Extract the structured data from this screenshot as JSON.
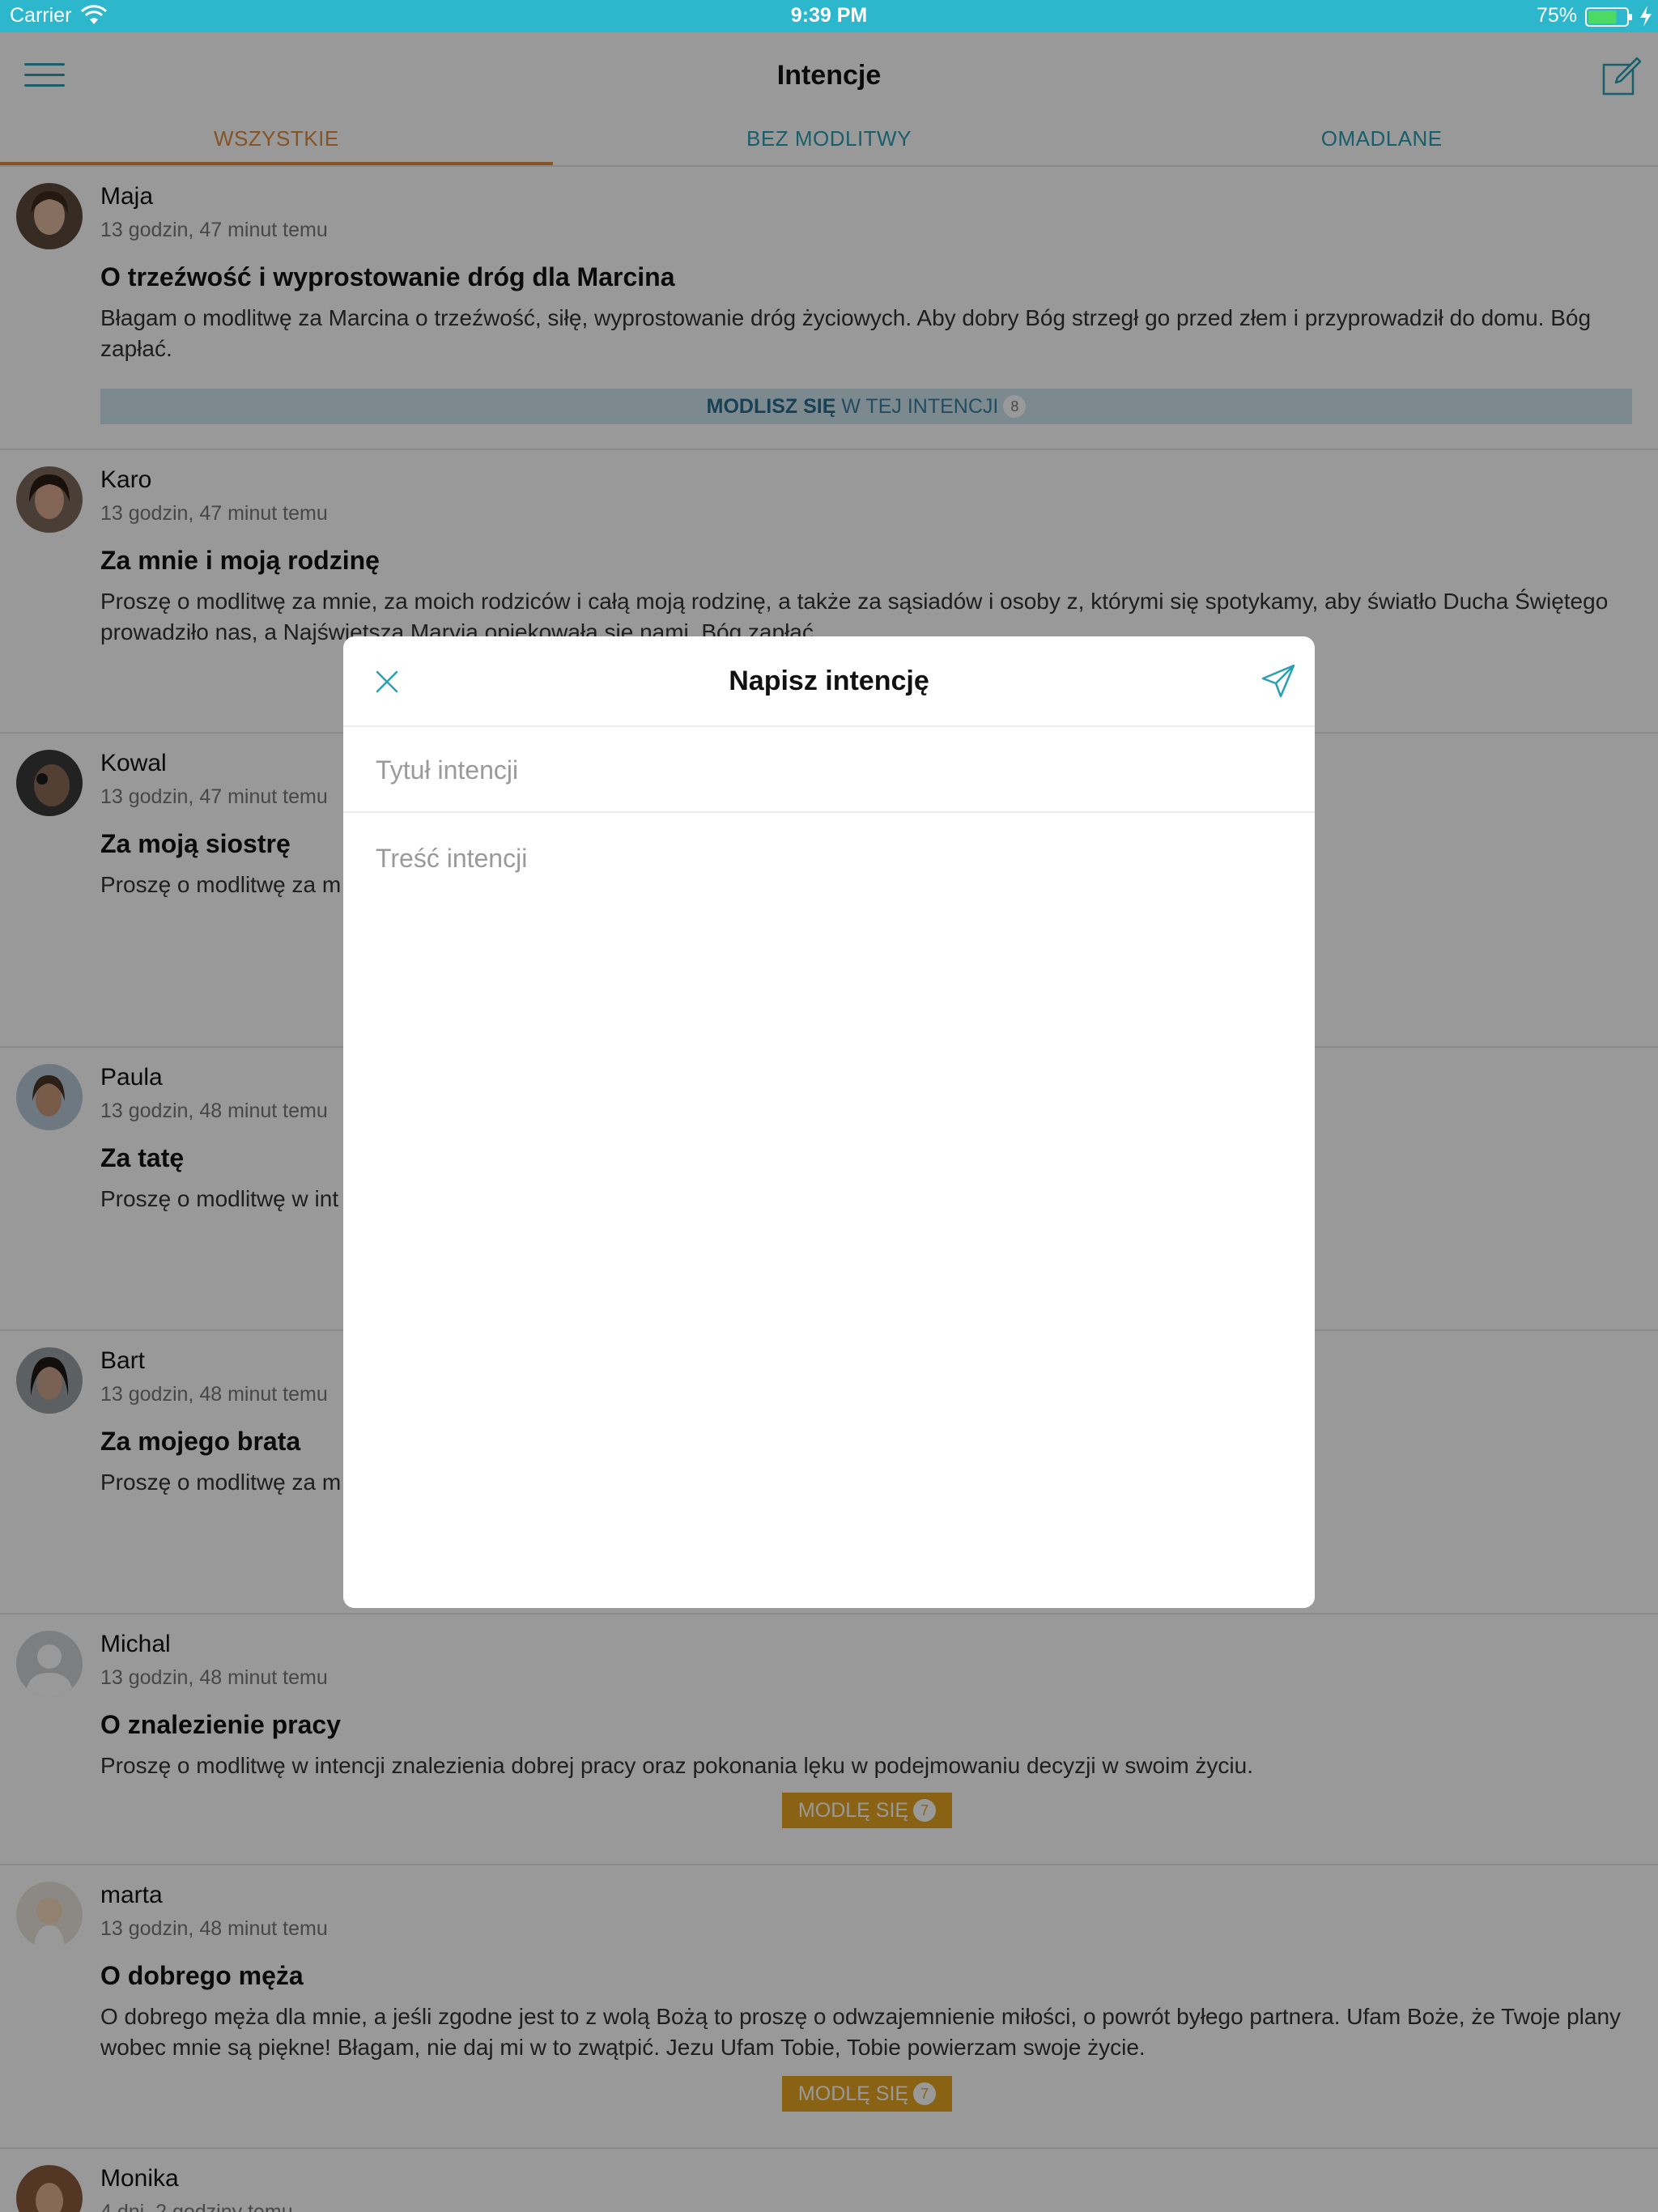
{
  "status_bar": {
    "carrier": "Carrier",
    "time": "9:39 PM",
    "battery": "75%",
    "battery_level": 0.75
  },
  "nav": {
    "title": "Intencje"
  },
  "tabs": [
    {
      "label": "WSZYSTKIE",
      "active": true
    },
    {
      "label": "BEZ MODLITWY",
      "active": false
    },
    {
      "label": "OMADLANE",
      "active": false
    }
  ],
  "posts": [
    {
      "author": "Maja",
      "ago": "13 godzin, 47 minut temu",
      "title": "O trzeźwość i wyprostowanie dróg dla Marcina",
      "body": "Błagam o modlitwę za Marcina o trzeźwość, siłę, wyprostowanie dróg życiowych. Aby dobry Bóg strzegł go przed złem i przyprowadził do domu. Bóg zapłać.",
      "action_bold": "MODLISZ SIĘ",
      "action_rest": " W TEJ INTENCJI",
      "count": "8"
    },
    {
      "author": "Karo",
      "ago": "13 godzin, 47 minut temu",
      "title": "Za mnie i moją rodzinę",
      "body": "Proszę o modlitwę za mnie, za moich rodziców i całą moją rodzinę, a także za sąsiadów i osoby z, którymi się spotykamy, aby światło Ducha Świętego prowadziło nas, a Najświętsza Maryja opiekowała się nami. Bóg zapłać."
    },
    {
      "author": "Kowal",
      "ago": "13 godzin, 47 minut temu",
      "title": "Za moją siostrę",
      "body": "Proszę o modlitwę za m                                                                                                                  ona, kiedy próbujemy jej pomóc, odpycha nas je                                                                                                                oprowadza nas do łez. Dziękuję wszystkim, kto"
    },
    {
      "author": "Paula",
      "ago": "13 godzin, 48 minut temu",
      "title": "Za tatę",
      "body": "Proszę o modlitwę w int                                                                                                                   ślubowanie abstynencji od alkoholu. Wierzę, że wy"
    },
    {
      "author": "Bart",
      "ago": "13 godzin, 48 minut temu",
      "title": "Za mojego brata",
      "body": "Proszę o modlitwę za m                                                                                                                    iędzmi. Bardzo proszę, sprawa jest poważna."
    },
    {
      "author": "Michal",
      "ago": "13 godzin, 48 minut temu",
      "title": "O znalezienie pracy",
      "body": "Proszę o modlitwę w intencji znalezienia dobrej pracy oraz pokonania lęku w podejmowaniu decyzji w swoim życiu.",
      "button": "MODLĘ SIĘ",
      "count": "7"
    },
    {
      "author": "marta",
      "ago": "13 godzin, 48 minut temu",
      "title": "O dobrego męża",
      "body": "O dobrego męża dla mnie, a jeśli zgodne jest to z wolą Bożą to proszę o odwzajemnienie miłości, o powrót byłego partnera. Ufam Boże, że Twoje plany wobec mnie są piękne! Błagam, nie daj mi w to zwątpić. Jezu Ufam Tobie, Tobie powierzam swoje życie.",
      "button": "MODLĘ SIĘ",
      "count": "7"
    },
    {
      "author": "Monika",
      "ago": "4 dni, 2 godziny temu"
    }
  ],
  "modal": {
    "title": "Napisz intencję",
    "title_placeholder": "Tytuł intencji",
    "body_placeholder": "Treść intencji"
  },
  "colors": {
    "accent": "#2cb7cc",
    "active_tab": "#e08a3c",
    "pray_button": "#e5a520",
    "prayed_bar": "#cfe6f0"
  }
}
